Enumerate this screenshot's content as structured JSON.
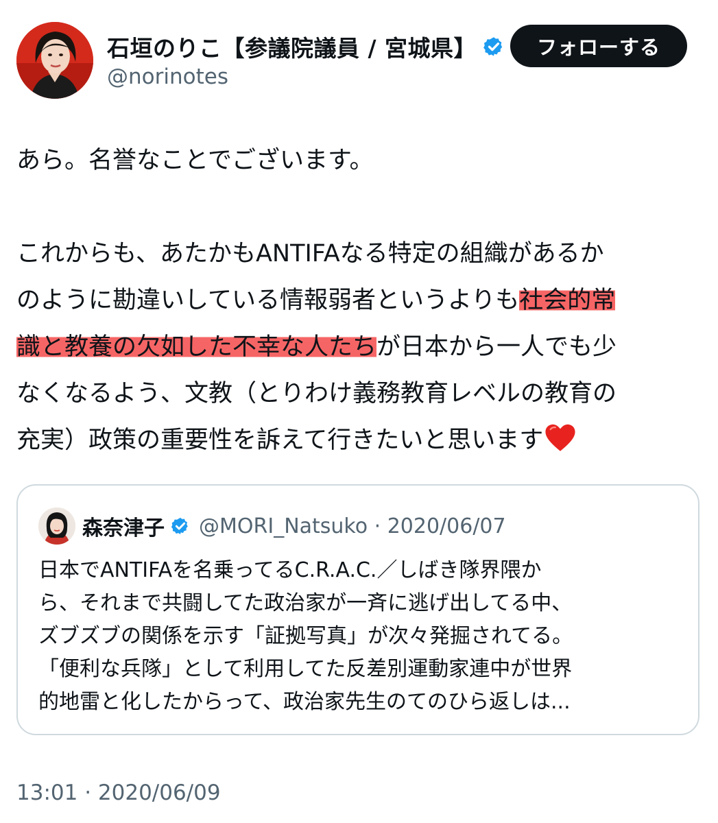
{
  "author": {
    "display_name": "石垣のりこ【参議院議員 / 宮城県】",
    "handle": "@norinotes",
    "verified": true
  },
  "follow_button": {
    "label": "フォローする"
  },
  "tweet": {
    "line1": "あら。名誉なことでございます。",
    "line2": "これからも、あたかもANTIFAなる特定の組織があるか",
    "line3_a": "のように勘違いしている情報弱者というよりも",
    "line3_b": "社会的常",
    "line4_a": "識と教養の欠如した不幸な人たち",
    "line4_b": "が日本から一人でも少",
    "line5": "なくなるよう、文教（とりわけ義務教育レベルの教育の",
    "line6": "充実）政策の重要性を訴えて行きたいと思います",
    "emoji": "red-heart-emoji",
    "highlight_color": "#f44a4a"
  },
  "quoted_tweet": {
    "display_name": "森奈津子",
    "handle_date": "@MORI_Natsuko · 2020/06/07",
    "verified": true,
    "lines": [
      "日本でANTIFAを名乗ってるC.R.A.C.／しばき隊界隈か",
      "ら、それまで共闘してた政治家が一斉に逃げ出してる中、",
      "ズブズブの関係を示す「証拠写真」が次々発掘されてる。",
      "「便利な兵隊」として利用してた反差別運動家連中が世界",
      "的地雷と化したからって、政治家先生のてのひら返しは..."
    ]
  },
  "timestamp": "13:01 · 2020/06/09",
  "colors": {
    "text": "#0f1419",
    "secondary": "#536471",
    "verified_blue": "#1d9bf0",
    "border": "#cfd9de"
  }
}
